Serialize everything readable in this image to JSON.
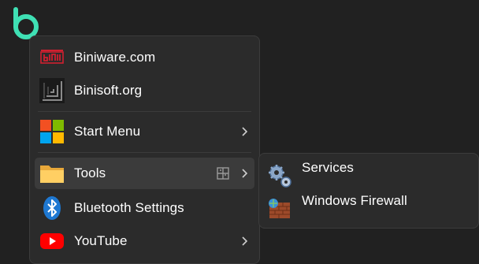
{
  "app_icon": "biniware-ring-logo",
  "menu": {
    "items": [
      {
        "label": "Biniware.com",
        "icon": "biniware-logo-icon",
        "has_submenu": false
      },
      {
        "label": "Binisoft.org",
        "icon": "binisoft-logo-icon",
        "has_submenu": false
      },
      {
        "label": "Start Menu",
        "icon": "windows-logo-icon",
        "has_submenu": true
      },
      {
        "label": "Tools",
        "icon": "folder-icon",
        "has_submenu": true,
        "badge_icon": "pin-grid-icon",
        "highlighted": true
      },
      {
        "label": "Bluetooth Settings",
        "icon": "bluetooth-icon",
        "has_submenu": false
      },
      {
        "label": "YouTube",
        "icon": "youtube-icon",
        "has_submenu": true
      }
    ]
  },
  "submenu": {
    "items": [
      {
        "label": "Services",
        "icon": "gears-icon"
      },
      {
        "label": "Windows Firewall",
        "icon": "firewall-brick-icon"
      }
    ]
  },
  "colors": {
    "background": "#212121",
    "menu_background": "#2b2b2b",
    "highlight": "#3b3b3b",
    "logo_accent": "#3fe0b4"
  }
}
